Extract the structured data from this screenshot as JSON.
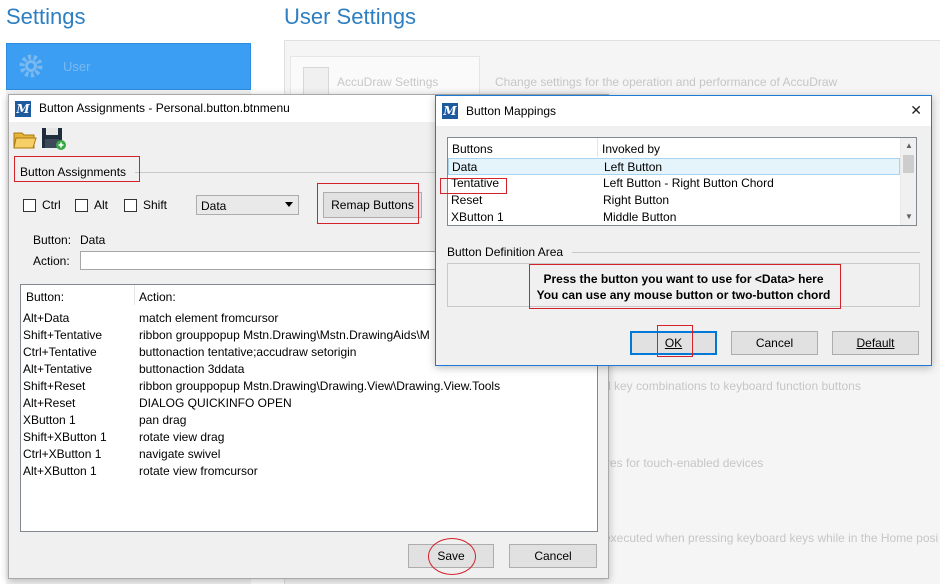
{
  "settings_page": {
    "left_title": "Settings",
    "main_title": "User Settings",
    "sidebar_user_label": "User",
    "card_label": "AccuDraw Settings",
    "descriptions": [
      "Change settings for the operation and performance of AccuDraw",
      "d key combinations to keyboard function buttons",
      "tures for touch-enabled devices",
      "executed when pressing keyboard keys while in the Home posi"
    ]
  },
  "button_assignments": {
    "title": "Button Assignments - Personal.button.btnmenu",
    "group_label": "Button Assignments",
    "modifiers": {
      "ctrl": "Ctrl",
      "alt": "Alt",
      "shift": "Shift"
    },
    "button_select_value": "Data",
    "remap_label": "Remap Buttons",
    "button_label": "Button:",
    "button_value": "Data",
    "action_label": "Action:",
    "action_value": "",
    "columns": [
      "Button:",
      "Action:"
    ],
    "rows": [
      [
        "Alt+Data",
        "match element fromcursor"
      ],
      [
        "Shift+Tentative",
        "ribbon grouppopup Mstn.Drawing\\Mstn.DrawingAids\\M"
      ],
      [
        "Ctrl+Tentative",
        "buttonaction tentative;accudraw setorigin"
      ],
      [
        "Alt+Tentative",
        "buttonaction 3ddata"
      ],
      [
        "Shift+Reset",
        "ribbon grouppopup Mstn.Drawing\\Drawing.View\\Drawing.View.Tools"
      ],
      [
        "Alt+Reset",
        "DIALOG QUICKINFO OPEN"
      ],
      [
        "XButton 1",
        "pan drag"
      ],
      [
        "Shift+XButton 1",
        "rotate view drag"
      ],
      [
        "Ctrl+XButton 1",
        "navigate swivel"
      ],
      [
        "Alt+XButton 1",
        "rotate view fromcursor"
      ]
    ],
    "save_label": "Save",
    "cancel_label": "Cancel"
  },
  "button_mappings": {
    "title": "Button Mappings",
    "close_glyph": "✕",
    "columns": [
      "Buttons",
      "Invoked by"
    ],
    "rows": [
      [
        "Data",
        "Left Button"
      ],
      [
        "Tentative",
        "Left Button - Right Button Chord"
      ],
      [
        "Reset",
        "Right Button"
      ],
      [
        "XButton 1",
        "Middle Button"
      ]
    ],
    "definition_area_label": "Button Definition Area",
    "instruction_line1": "Press the button you want to use for <Data> here",
    "instruction_line2": "You can use any mouse button or two-button chord",
    "ok_label": "OK",
    "cancel_label": "Cancel",
    "default_label": "Default"
  },
  "colors": {
    "accent_blue": "#2d7fc1",
    "annotation_red": "#d2232a",
    "selection_blue": "#0078d7"
  }
}
